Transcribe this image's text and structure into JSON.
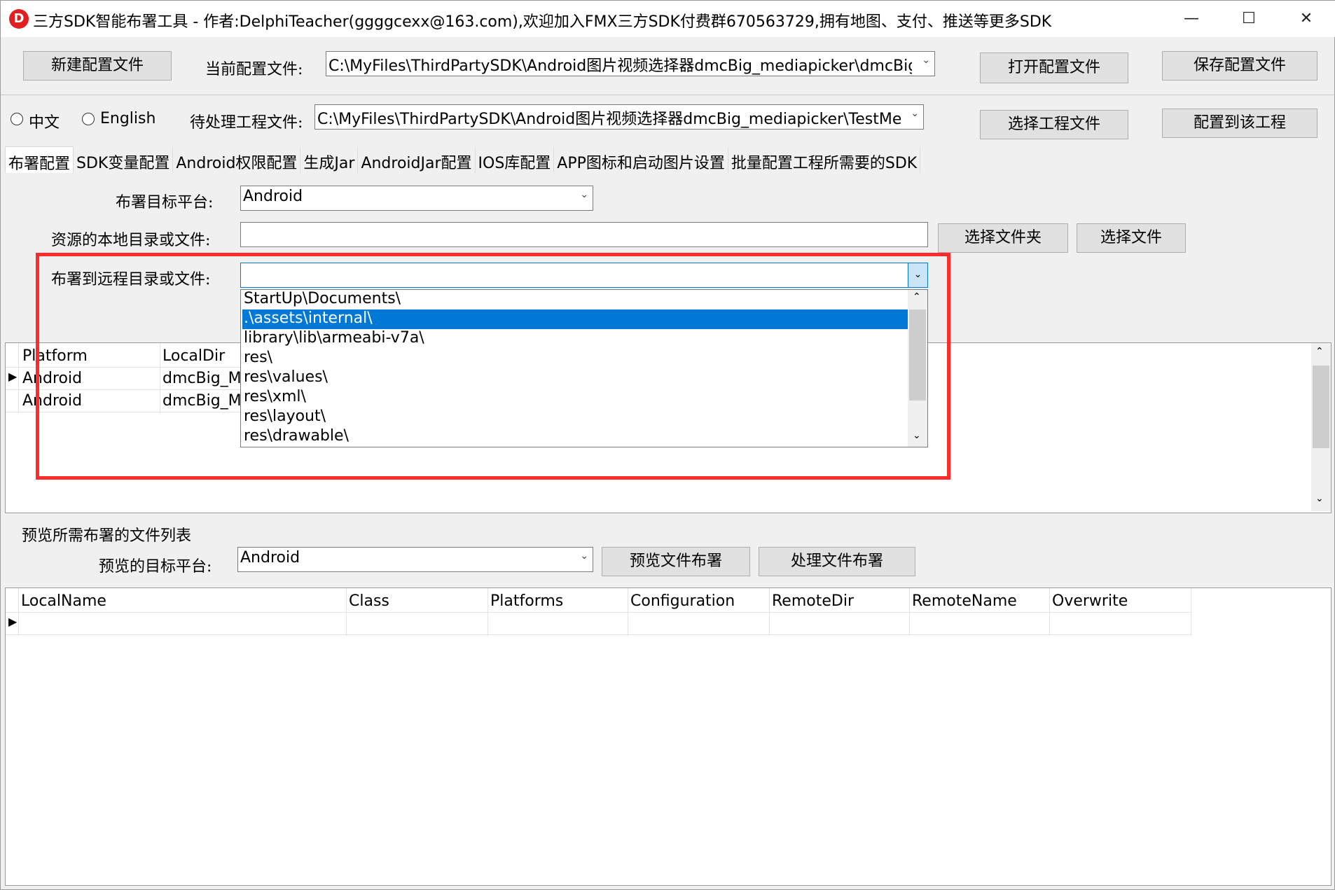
{
  "window": {
    "title": "三方SDK智能布署工具 - 作者:DelphiTeacher(ggggcexx@163.com),欢迎加入FMX三方SDK付费群670563729,拥有地图、支付、推送等更多SDK",
    "icon_letter": "D",
    "minimize": "—",
    "maximize": "☐",
    "close": "✕"
  },
  "toolbar": {
    "new_config": "新建配置文件",
    "current_config_label": "当前配置文件:",
    "current_config_value": "C:\\MyFiles\\ThirdPartySDK\\Android图片视频选择器dmcBig_mediapicker\\dmcBig_M",
    "open_config": "打开配置文件",
    "save_config": "保存配置文件",
    "lang_chinese": "中文",
    "lang_english": "English",
    "project_label": "待处理工程文件:",
    "project_value": "C:\\MyFiles\\ThirdPartySDK\\Android图片视频选择器dmcBig_mediapicker\\TestMediaP",
    "select_project": "选择工程文件",
    "apply_project": "配置到该工程"
  },
  "tabs": [
    {
      "label": "布署配置",
      "active": true
    },
    {
      "label": "SDK变量配置"
    },
    {
      "label": "Android权限配置"
    },
    {
      "label": "生成Jar"
    },
    {
      "label": "AndroidJar配置"
    },
    {
      "label": "IOS库配置"
    },
    {
      "label": "APP图标和启动图片设置"
    },
    {
      "label": "批量配置工程所需要的SDK"
    }
  ],
  "deploy": {
    "platform_label": "布署目标平台:",
    "platform_value": "Android",
    "local_label": "资源的本地目录或文件:",
    "local_value": "",
    "select_folder": "选择文件夹",
    "select_file": "选择文件",
    "remote_label": "布署到远程目录或文件:",
    "remote_value": "",
    "remote_options": [
      "StartUp\\Documents\\",
      ".\\assets\\internal\\",
      "library\\lib\\armeabi-v7a\\",
      "res\\",
      "res\\values\\",
      "res\\xml\\",
      "res\\layout\\",
      "res\\drawable\\"
    ],
    "remote_selected_index": 1
  },
  "deploy_grid": {
    "headers": [
      "Platform",
      "LocalDir"
    ],
    "rows": [
      [
        "Android",
        "dmcBig_Me"
      ],
      [
        "Android",
        "dmcBig_Me"
      ]
    ],
    "row_indicator": "▶"
  },
  "preview": {
    "section_label": "预览所需布署的文件列表",
    "platform_label": "预览的目标平台:",
    "platform_value": "Android",
    "preview_button": "预览文件布署",
    "process_button": "处理文件布署"
  },
  "preview_grid": {
    "headers": [
      "LocalName",
      "Class",
      "Platforms",
      "Configuration",
      "RemoteDir",
      "RemoteName",
      "Overwrite"
    ],
    "row_indicator": "▶"
  },
  "colors": {
    "highlight_box": "#ff2a2a",
    "selection": "#0078d7"
  }
}
